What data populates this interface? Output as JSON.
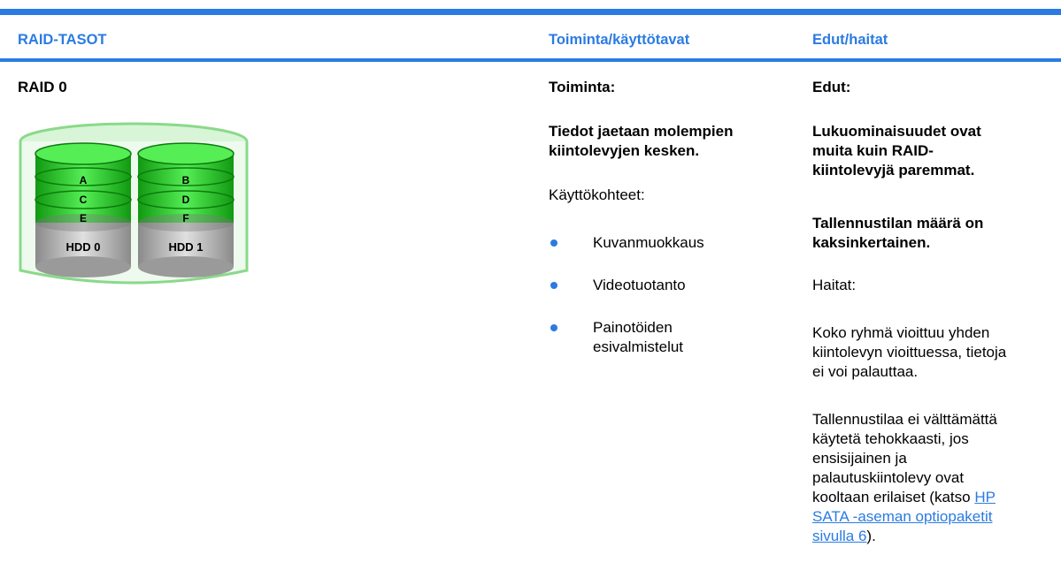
{
  "header": {
    "col1": "RAID-TASOT",
    "col2": "Toiminta/käyttötavat",
    "col3": "Edut/haitat"
  },
  "row": {
    "level": "RAID 0",
    "figure": {
      "disk_left_labels": [
        "A",
        "C",
        "E"
      ],
      "disk_right_labels": [
        "B",
        "D",
        "F"
      ],
      "disk_left_name": "HDD 0",
      "disk_right_name": "HDD 1",
      "colors": {
        "green": "#22cc22",
        "gray": "#b0b0b0"
      }
    },
    "function": {
      "heading": "Toiminta:",
      "desc_line1": "Tiedot jaetaan molempien",
      "desc_line2": "kiintolevyjen kesken.",
      "uses_heading": "Käyttökohteet:",
      "uses": [
        "Kuvanmuokkaus",
        "Videotuotanto",
        "Painotöiden",
        "esivalmistelut"
      ]
    },
    "pros_cons": {
      "pros_heading": "Edut:",
      "pro1_lines": [
        "Lukuominaisuudet ovat",
        "muita kuin RAID-",
        "kiintolevyjä paremmat."
      ],
      "pro2_lines": [
        "Tallennustilan määrä on",
        "kaksinkertainen."
      ],
      "cons_heading": "Haitat:",
      "con1_lines": [
        "Koko ryhmä vioittuu yhden",
        "kiintolevyn vioittuessa, tietoja",
        "ei voi palauttaa."
      ],
      "con2_lines": [
        "Tallennustilaa ei välttämättä",
        "käytetä tehokkaasti, jos",
        "ensisijainen ja",
        "palautuskiintolevy ovat"
      ],
      "con2_tail_text": "kooltaan erilaiset (katso ",
      "link_part1": "HP",
      "link_part2": "SATA -aseman optiopaketit",
      "link_part3": "sivulla 6",
      "con2_end": ")."
    }
  }
}
